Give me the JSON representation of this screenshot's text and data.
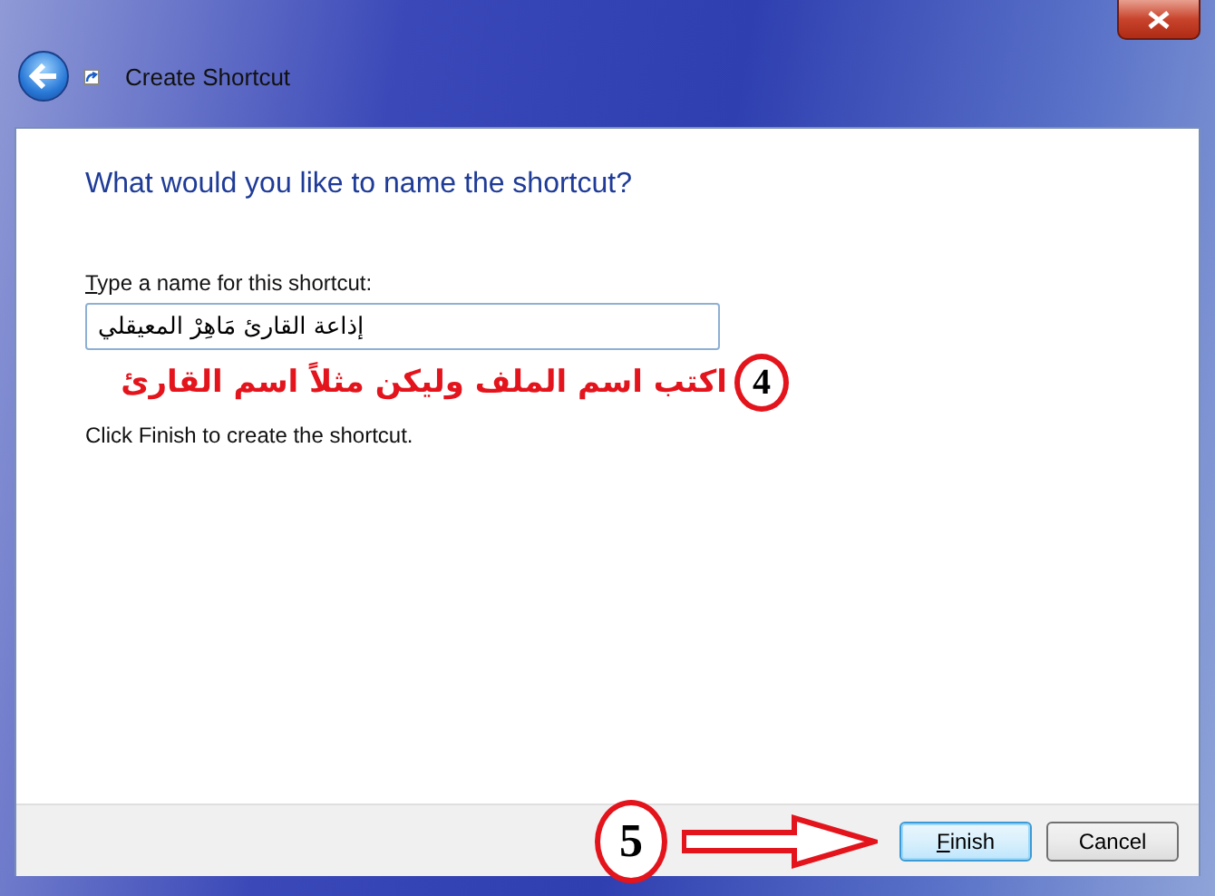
{
  "window": {
    "title": "Create Shortcut"
  },
  "heading": "What would you like to name the shortcut?",
  "name_field": {
    "label": "Type a name for this shortcut:",
    "value": "إذاعة القارئ مَاهِرْ المعيقلي"
  },
  "annotations": [
    {
      "kind": "note",
      "number": "4",
      "text": "اكتب اسم الملف وليكن مثلاً اسم القارئ"
    },
    {
      "kind": "arrow",
      "number": "5"
    }
  ],
  "hint": "Click Finish to create the shortcut.",
  "buttons": [
    {
      "label": "Finish",
      "default": true
    },
    {
      "label": "Cancel",
      "default": false
    }
  ]
}
